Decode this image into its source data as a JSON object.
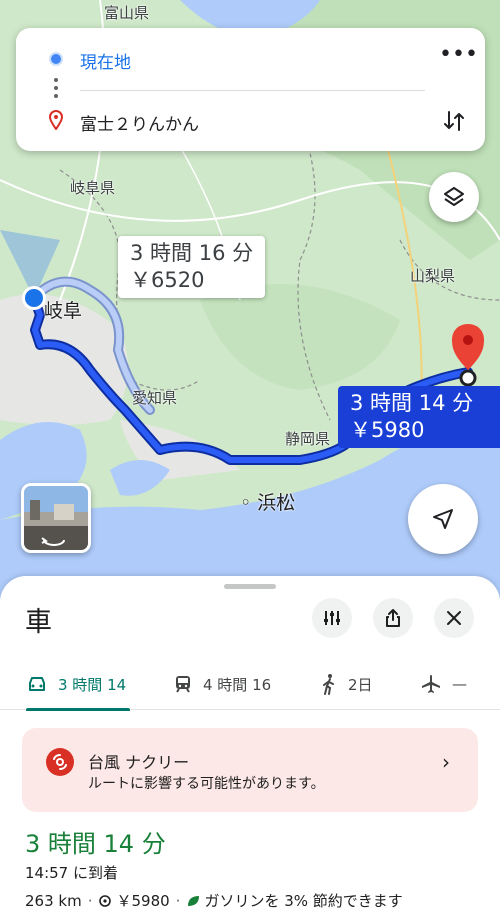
{
  "search": {
    "origin": "現在地",
    "destination": "富士２りんかん",
    "more": "•••"
  },
  "map": {
    "labels": {
      "toyama": "富山県",
      "gifu_pref": "岐阜県",
      "gifu_city": "岐阜",
      "aichi": "愛知県",
      "yamanashi": "山梨県",
      "shizuoka": "静岡県",
      "hamamatsu": "浜松"
    },
    "alt_route": {
      "time": "3 時間 16 分",
      "toll": "￥6520"
    },
    "main_route": {
      "time": "3 時間 14 分",
      "toll": "￥5980"
    },
    "colors": {
      "route": "#1a3fd6",
      "route_alt": "#a8c4f8",
      "water": "#aecbfa",
      "land": "#cfe8c9"
    }
  },
  "sheet": {
    "title": "車",
    "tabs": [
      {
        "icon": "car-icon",
        "label": "3 時間 14",
        "active": true
      },
      {
        "icon": "train-icon",
        "label": "4 時間 16",
        "active": false
      },
      {
        "icon": "walk-icon",
        "label": "2日",
        "active": false
      },
      {
        "icon": "flight-icon",
        "label": "—",
        "active": false
      }
    ],
    "alert": {
      "title": "台風 ナクリー",
      "desc": "ルートに影響する可能性があります。"
    },
    "duration": "3 時間 14 分",
    "arrival": "14:57 に到着",
    "distance": "263 km",
    "toll": "￥5980",
    "eco": "ガソリンを 3% 節約できます"
  }
}
